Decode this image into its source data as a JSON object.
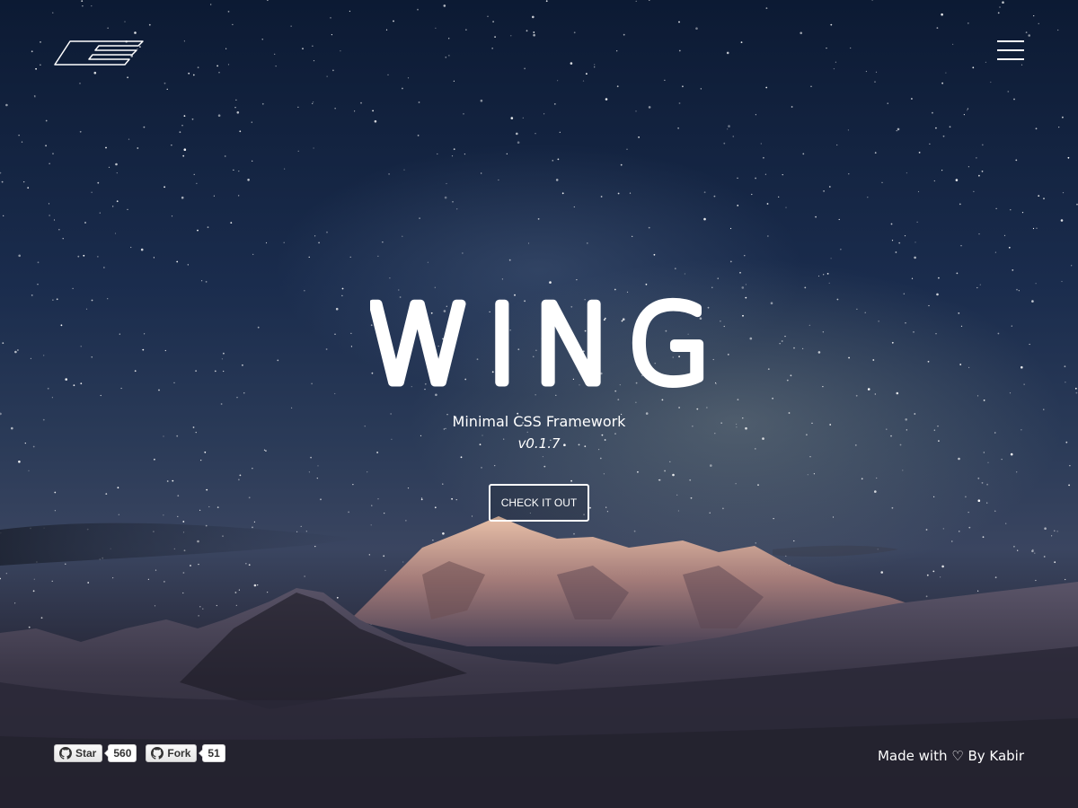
{
  "hero": {
    "title": "WING",
    "subtitle": "Minimal CSS Framework",
    "version": "v0.1.7",
    "cta_label": "CHECK IT OUT"
  },
  "github": {
    "star_label": "Star",
    "star_count": "560",
    "fork_label": "Fork",
    "fork_count": "51"
  },
  "footer": {
    "credit": "Made with ♡ By Kabir"
  },
  "icons": {
    "logo": "wing-logo-icon",
    "menu": "hamburger-menu-icon",
    "github": "github-icon"
  },
  "colors": {
    "text": "#ffffff",
    "sky_top": "#0c1a33",
    "snow": "#2a2838"
  }
}
